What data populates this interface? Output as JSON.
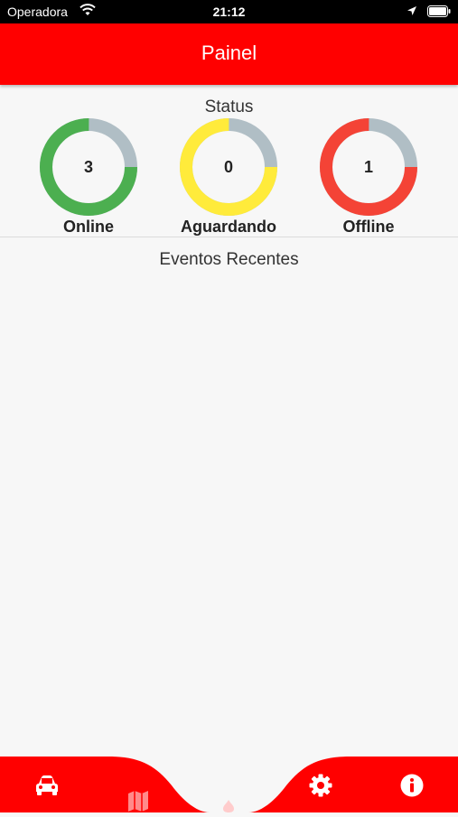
{
  "status_bar": {
    "carrier": "Operadora",
    "time": "21:12"
  },
  "app_bar": {
    "title": "Painel",
    "color": "#ff0000"
  },
  "status_section": {
    "title": "Status",
    "items": [
      {
        "label": "Online",
        "count": "3",
        "color": "#4caf50",
        "fraction": 0.75
      },
      {
        "label": "Aguardando",
        "count": "0",
        "color": "#ffeb3b",
        "fraction": 0.75
      },
      {
        "label": "Offline",
        "count": "1",
        "color": "#f44336",
        "fraction": 0.75
      }
    ],
    "track_color": "#b0bec5"
  },
  "events_section": {
    "title": "Eventos Recentes"
  },
  "bottom_nav": {
    "items": [
      {
        "icon": "car-icon"
      },
      {
        "icon": "map-icon"
      },
      {
        "icon": "fire-icon"
      },
      {
        "icon": "gear-icon"
      },
      {
        "icon": "info-icon"
      }
    ]
  }
}
